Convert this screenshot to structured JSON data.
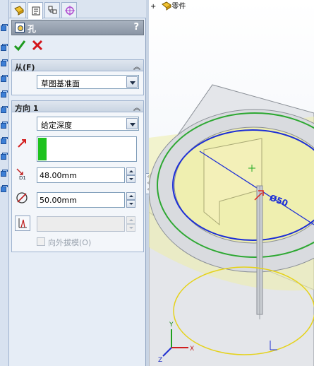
{
  "feature_title": "孔",
  "help_label": "?",
  "tree_item": "零件",
  "from_group": {
    "title": "从(F)",
    "selected": "草图基准面"
  },
  "direction_group": {
    "title": "方向 1",
    "end_condition": "给定深度",
    "depth_value": "48.00mm",
    "diameter_value": "50.00mm",
    "draft_value": "",
    "draft_outward_label": "向外拔模(O)"
  },
  "dimension_label": "Ø50",
  "axis_labels": {
    "y": "Y",
    "z": "Z",
    "x": "X"
  },
  "colors": {
    "accent_green": "#1ec21e",
    "accent_red": "#e0251b",
    "sketch_blue": "#1d2fd6",
    "face_yellow": "#efefb0",
    "edge_green": "#2da832"
  }
}
